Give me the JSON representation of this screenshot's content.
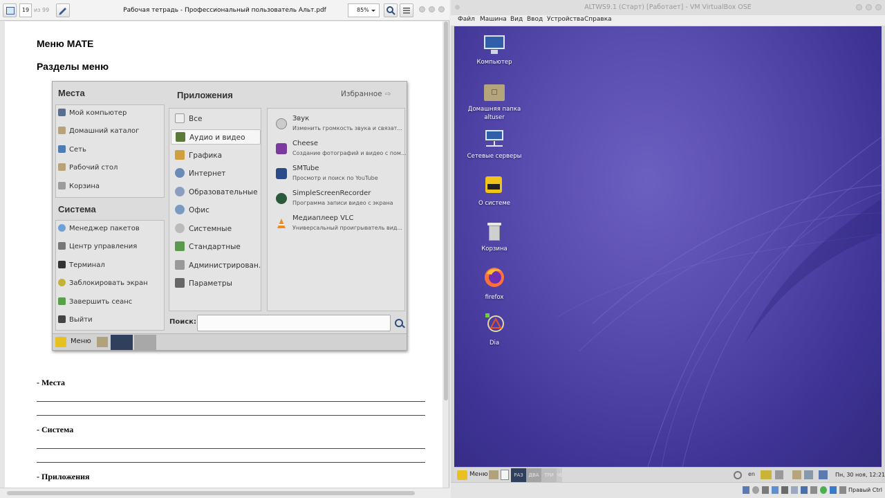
{
  "pdf_viewer": {
    "title": "Рабочая тетрадь - Профессиональный пользователь Альт.pdf",
    "current_page": "19",
    "page_total": "из 99",
    "zoom": "85%"
  },
  "document": {
    "heading1": "Меню MATE",
    "heading2": "Разделы меню",
    "section_places": "- Места",
    "section_system": "- Система",
    "section_apps": "- Приложения"
  },
  "mate_menu": {
    "places_title": "Места",
    "places": [
      "Мой компьютер",
      "Домашний каталог",
      "Сеть",
      "Рабочий стол",
      "Корзина"
    ],
    "system_title": "Система",
    "system": [
      "Менеджер пакетов",
      "Центр управления",
      "Терминал",
      "Заблокировать экран",
      "Завершить сеанс",
      "Выйти"
    ],
    "apps_title": "Приложения",
    "favorites": "Избранное",
    "categories": [
      "Все",
      "Аудио и видео",
      "Графика",
      "Интернет",
      "Образовательные",
      "Офис",
      "Системные",
      "Стандартные",
      "Администрирован...",
      "Параметры"
    ],
    "active_category": "Аудио и видео",
    "apps": [
      {
        "name": "Звук",
        "desc": "Изменить громкость звука и связат..."
      },
      {
        "name": "Cheese",
        "desc": "Создание фотографий и видео с пом..."
      },
      {
        "name": "SMTube",
        "desc": "Просмотр и поиск по YouTube"
      },
      {
        "name": "SimpleScreenRecorder",
        "desc": "Программа записи видео с экрана"
      },
      {
        "name": "Медиаплеер VLC",
        "desc": "Универсальный проигрыватель вид..."
      }
    ],
    "search_label": "Поиск:",
    "taskbar_menu": "Меню"
  },
  "vbox": {
    "title": "ALTWS9.1 (Старт) [Работает] - VM VirtualBox OSE",
    "menu": [
      "Файл",
      "Машина",
      "Вид",
      "Ввод",
      "Устройства",
      "Справка"
    ],
    "host_key": "Правый Ctrl"
  },
  "desktop": {
    "icons": [
      {
        "label": "Компьютер",
        "icon": "computer-icon"
      },
      {
        "label": "Домашняя папка altuser",
        "icon": "home-folder-icon"
      },
      {
        "label": "Сетевые серверы",
        "icon": "network-servers-icon"
      },
      {
        "label": "О системе",
        "icon": "basealt-icon"
      },
      {
        "label": "Корзина",
        "icon": "trash-icon"
      },
      {
        "label": "firefox",
        "icon": "firefox-icon"
      },
      {
        "label": "Dia",
        "icon": "dia-icon"
      }
    ]
  },
  "vm_panel": {
    "menu_label": "Меню",
    "workspaces": [
      "РАЗ",
      "ДВА",
      "ТРИ",
      "ЧЕТ"
    ],
    "lang": "en",
    "clock": "Пн, 30 ноя, 12:21"
  },
  "colors": {
    "desktop_bg": "#4a3fa2",
    "active_workspace": "#2f3f5c"
  }
}
